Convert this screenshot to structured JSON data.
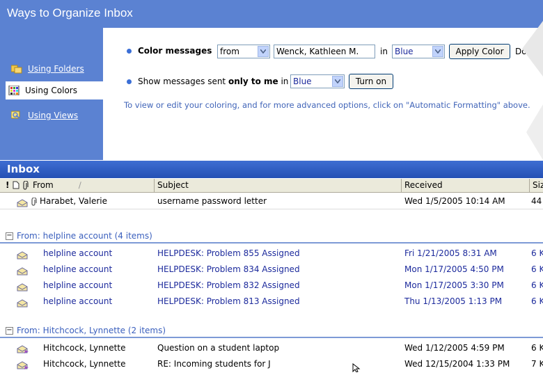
{
  "organize": {
    "title": "Ways to Organize Inbox",
    "nav": [
      {
        "label": "Using Folders",
        "icon": "folders-icon",
        "state": "link"
      },
      {
        "label": "Using Colors",
        "icon": "colors-grid-icon",
        "state": "active"
      },
      {
        "label": "Using Views",
        "icon": "views-icon",
        "state": "link"
      }
    ],
    "color_messages": {
      "label": "Color messages",
      "from_select": "from",
      "name_field": "Wenck, Kathleen M.",
      "in_label": "in",
      "color_select": "Blue",
      "apply_button": "Apply Color",
      "done_label": "Done"
    },
    "show_messages": {
      "prefix": "Show messages sent ",
      "bold": "only to me",
      "suffix": " in",
      "color_select": "Blue",
      "turn_on_button": "Turn on"
    },
    "hint": "To view or edit your coloring, and for more advanced options, click on \"Automatic Formatting\" above."
  },
  "inbox": {
    "title": "Inbox",
    "columns": {
      "from": "From",
      "subject": "Subject",
      "received": "Received",
      "size": "Siz"
    },
    "top_row": {
      "from": "Harabet, Valerie",
      "subject": "username password letter",
      "received": "Wed 1/5/2005 10:14 AM",
      "size": "44"
    },
    "groups": [
      {
        "label": "From: helpline account (4 items)",
        "rows": [
          {
            "from": "helpline account",
            "subject": "HELPDESK: Problem 855 Assigned",
            "received": "Fri 1/21/2005 8:31 AM",
            "size": "6 K"
          },
          {
            "from": "helpline account",
            "subject": "HELPDESK: Problem 834 Assigned",
            "received": "Mon 1/17/2005 4:50 PM",
            "size": "6 K"
          },
          {
            "from": "helpline account",
            "subject": "HELPDESK: Problem 832 Assigned",
            "received": "Mon 1/17/2005 3:30 PM",
            "size": "6 K"
          },
          {
            "from": "helpline account",
            "subject": "HELPDESK: Problem 813 Assigned",
            "received": "Thu 1/13/2005 1:13 PM",
            "size": "6 K"
          }
        ]
      },
      {
        "label": "From: Hitchcock, Lynnette (2 items)",
        "rows": [
          {
            "from": "Hitchcock, Lynnette",
            "subject": "Question on a student laptop",
            "received": "Wed 1/12/2005 4:59 PM",
            "size": "6 K"
          },
          {
            "from": "Hitchcock, Lynnette",
            "subject": "RE: Incoming students for J",
            "received": "Wed 12/15/2004 1:33 PM",
            "size": "7 K"
          }
        ]
      }
    ]
  }
}
